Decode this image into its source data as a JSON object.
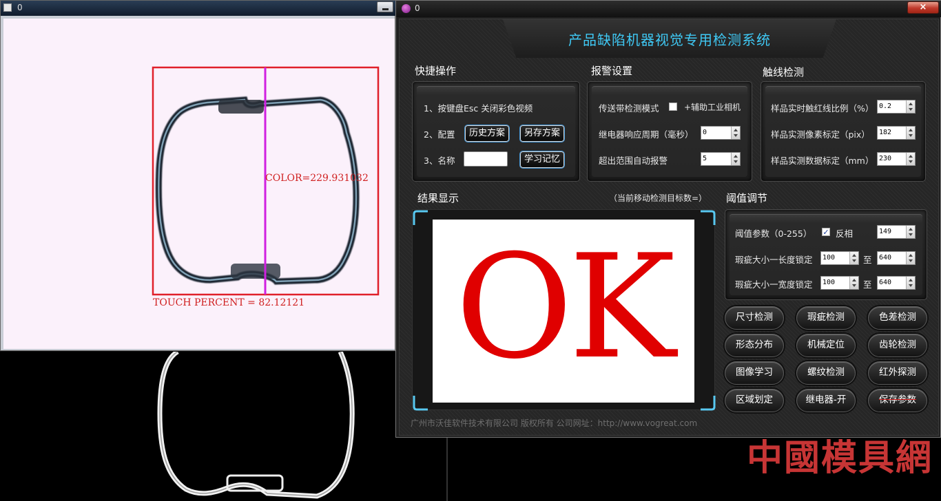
{
  "camera_window": {
    "title": "0",
    "overlay": {
      "color_text": "COLOR=229.931032",
      "touch_text": "TOUCH PERCENT = 82.12121"
    }
  },
  "app": {
    "window_title": "0",
    "close_glyph": "×",
    "heading": "产品缺陷机器视觉专用检测系统",
    "quick_ops": {
      "title": "快捷操作",
      "row1": "1、按键盘Esc   关闭彩色视频",
      "row2_label": "2、配置",
      "history_btn": "历史方案",
      "save_as_btn": "另存方案",
      "row3_label": "3、名称",
      "name_value": "",
      "learn_btn": "学习记忆"
    },
    "alarm": {
      "title": "报警设置",
      "conveyor_label": "传送带检测模式",
      "aux_camera_label": "+辅助工业相机",
      "relay_label": "继电器响应周期（毫秒）",
      "relay_value": "0",
      "auto_alarm_label": "超出范围自动报警",
      "auto_alarm_value": "5"
    },
    "touch": {
      "title": "触线检测",
      "ratio_label": "样品实时触红线比例（%）",
      "ratio_value": "0.2",
      "pixel_label": "样品实测像素标定（pix）",
      "pixel_value": "182",
      "mm_label": "样品实测数据标定（mm）",
      "mm_value": "230"
    },
    "result": {
      "title": "结果显示",
      "note": "（当前移动检测目标数=）",
      "verdict": "OK"
    },
    "threshold": {
      "title": "阈值调节",
      "param_label": "阈值参数（0-255）",
      "invert_label": "反相",
      "invert_checked": true,
      "param_value": "149",
      "length_label": "瑕疵大小一长度锁定",
      "length_min": "100",
      "length_max": "640",
      "width_label": "瑕疵大小一宽度锁定",
      "width_min": "100",
      "width_max": "640",
      "to": "至"
    },
    "buttons": [
      [
        "尺寸检测",
        "瑕疵检测",
        "色差检测"
      ],
      [
        "形态分布",
        "机械定位",
        "齿轮检测"
      ],
      [
        "图像学习",
        "螺纹检测",
        "红外探测"
      ],
      [
        "区域划定",
        "继电器-开",
        "保存参数"
      ]
    ],
    "footer": "广州市沃佳软件技术有限公司  版权所有  公司网址：http://www.vogreat.com"
  },
  "watermark": "中國模具網",
  "colors": {
    "heading": "#3fc9f5",
    "verdict": "#e00000",
    "roi_box": "#e0202a",
    "center_line": "#d020e0",
    "watermark": "#d83a3a"
  }
}
